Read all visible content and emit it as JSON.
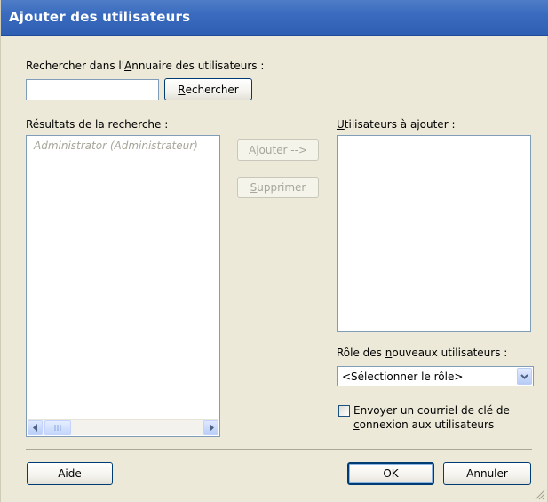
{
  "window": {
    "title": "Ajouter des utilisateurs"
  },
  "search": {
    "label_prefix": "Rechercher dans l'",
    "label_access": "A",
    "label_suffix": "nnuaire des utilisateurs :",
    "value": "",
    "button_access": "R",
    "button_rest": "echercher"
  },
  "results": {
    "label": "Résultats de la recherche :",
    "items": [
      "Administrator (Administrateur)"
    ]
  },
  "actions": {
    "add_access": "A",
    "add_rest": "jouter -->",
    "remove_access": "S",
    "remove_rest": "upprimer"
  },
  "to_add": {
    "label_access": "U",
    "label_rest": "tilisateurs à ajouter :",
    "items": []
  },
  "role": {
    "label_prefix": "Rôle des ",
    "label_access": "n",
    "label_suffix": "ouveaux utilisateurs :",
    "selected": "<Sélectionner le rôle>"
  },
  "email_option": {
    "line1": "Envoyer un courriel de clé de",
    "line2_access": "c",
    "line2_rest": "onnexion aux utilisateurs",
    "checked": false
  },
  "footer": {
    "help_label": "Aide",
    "ok_label": "OK",
    "cancel_label": "Annuler"
  },
  "colors": {
    "titlebar": "#3a6bbf",
    "dialog_bg": "#ece9d8",
    "field_border": "#7f9db9",
    "disabled_text": "#a7a69a"
  },
  "icons": {
    "scroll_left": "triangle-left",
    "scroll_right": "triangle-right",
    "dropdown": "chevron-down",
    "resize": "size-grip"
  }
}
